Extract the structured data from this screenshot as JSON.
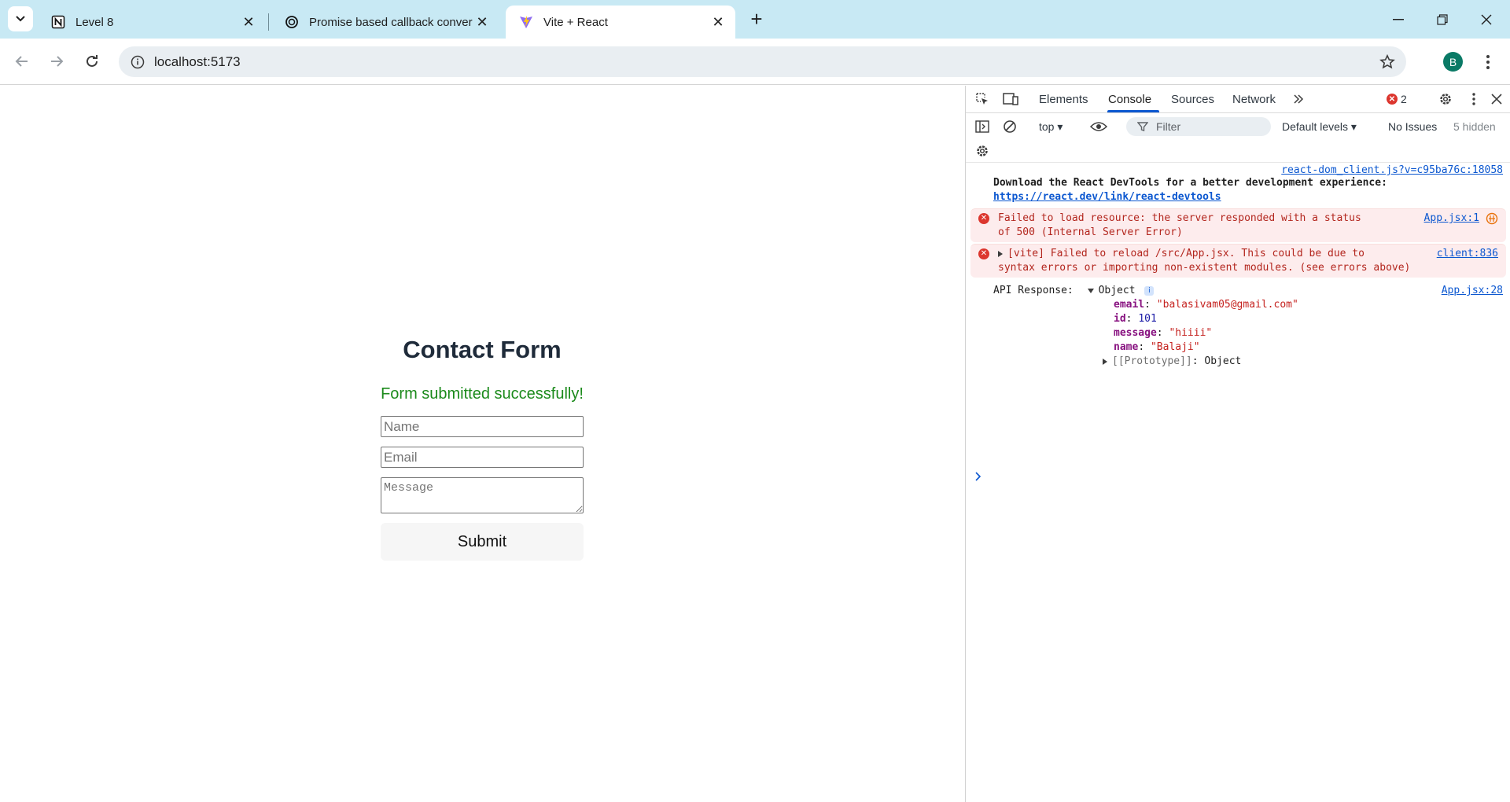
{
  "browser": {
    "tabs": [
      {
        "title": "Level 8",
        "icon": "notion-icon"
      },
      {
        "title": "Promise based callback convers",
        "icon": "chatgpt-icon"
      },
      {
        "title": "Vite + React",
        "icon": "vite-icon",
        "active": true
      }
    ],
    "url": "localhost:5173",
    "avatar_letter": "B"
  },
  "form": {
    "title": "Contact Form",
    "success": "Form submitted successfully!",
    "name_placeholder": "Name",
    "email_placeholder": "Email",
    "message_placeholder": "Message",
    "submit_label": "Submit"
  },
  "devtools": {
    "tabs": [
      "Elements",
      "Console",
      "Sources",
      "Network"
    ],
    "active_tab": "Console",
    "error_count": "2",
    "context": "top",
    "filter_placeholder": "Filter",
    "levels": "Default levels",
    "issues": "No Issues",
    "hidden": "5 hidden",
    "messages": {
      "devtools_src": "react-dom_client.js?v=c95ba76c:18058",
      "devtools_text": "Download the React DevTools for a better development experience:",
      "devtools_link": "https://react.dev/link/react-devtools",
      "error1_text_a": "Failed to load resource: the server responded with a status",
      "error1_text_b": "of 500 (Internal Server Error)",
      "error1_src": "App.jsx:1",
      "error2_text_a": "[vite] Failed to reload /src/App.jsx. This could be due to",
      "error2_text_b": "syntax errors or importing non-existent modules. (see errors above)",
      "error2_src": "client:836",
      "api_label": "API Response:",
      "api_type": "Object",
      "api_src": "App.jsx:28",
      "props": [
        {
          "key": "email",
          "value": "\"balasivam05@gmail.com\""
        },
        {
          "key": "id",
          "value": "101"
        },
        {
          "key": "message",
          "value": "\"hiiii\""
        },
        {
          "key": "name",
          "value": "\"Balaji\""
        }
      ],
      "proto_key": "[[Prototype]]",
      "proto_val": "Object"
    }
  },
  "colors": {
    "tabstrip": "#c8e9f4",
    "accent": "#0b57d0",
    "success": "#1b8a1b",
    "error": "#dc362e"
  }
}
